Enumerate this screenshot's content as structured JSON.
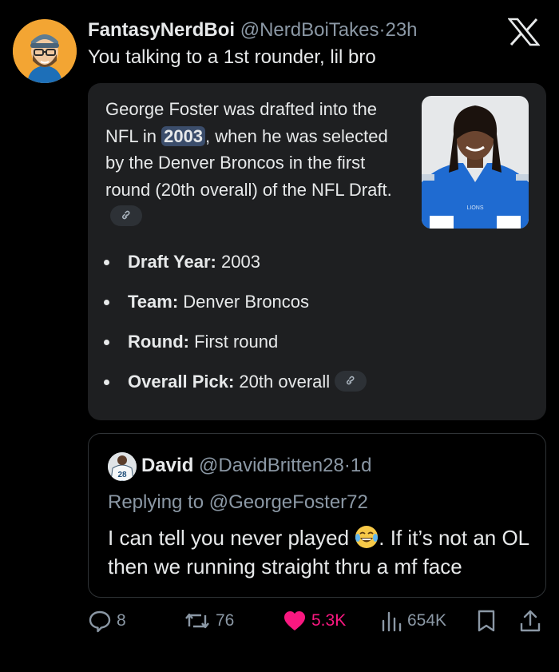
{
  "tweet": {
    "author_name": "FantasyNerdBoi",
    "author_handle": "@NerdBoiTakes",
    "separator": "·",
    "time": "23h",
    "text": "You talking to a 1st rounder, lil bro"
  },
  "grok_card": {
    "text_before": "George Foster was drafted into the NFL in ",
    "highlight": "2003",
    "text_after": ", when he was selected by the Denver Broncos in the first round (20th overall) of the NFL Draft.",
    "facts": [
      {
        "label": "Draft Year:",
        "value": " 2003"
      },
      {
        "label": "Team:",
        "value": " Denver Broncos"
      },
      {
        "label": "Round:",
        "value": " First round"
      },
      {
        "label": "Overall Pick:",
        "value": " 20th overall"
      }
    ]
  },
  "quoted_tweet": {
    "author_name": "David",
    "author_handle": "@DavidBritten28",
    "separator": "·",
    "time": "1d",
    "replying_to": "Replying to @GeorgeFoster72",
    "text_before_emoji": "I can tell you never played ",
    "emoji": "face-with-tears-of-joy",
    "text_after_emoji": ". If it’s not an OL then we running straight thru a mf face"
  },
  "actions": {
    "replies": "8",
    "reposts": "76",
    "likes": "5.3K",
    "views": "654K"
  },
  "colors": {
    "background": "#000000",
    "secondary_text": "#8b98a5",
    "like": "#f91880",
    "card": "#1e1f21",
    "highlight": "#3b4d6b",
    "avatar_bg": "#f3a533"
  },
  "icons": [
    "x-logo-icon",
    "link-icon",
    "reply-icon",
    "repost-icon",
    "heart-icon",
    "views-icon",
    "bookmark-icon",
    "share-icon"
  ]
}
